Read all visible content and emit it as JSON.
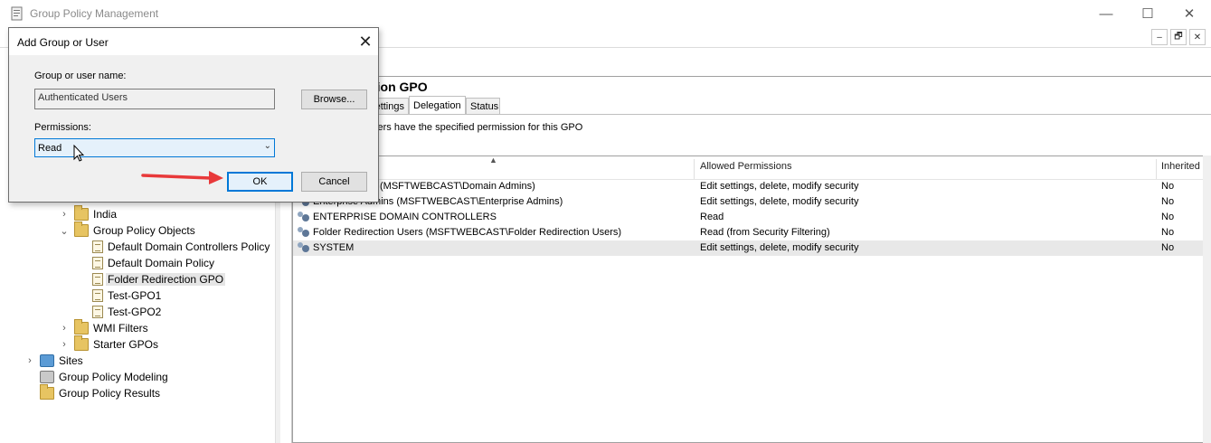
{
  "window": {
    "title": "Group Policy Management",
    "controls": [
      "—",
      "☐",
      "✕"
    ]
  },
  "mdi_controls": [
    "–",
    "🗗",
    "✕"
  ],
  "tree": {
    "nodes": [
      {
        "label": "India",
        "icon": "folder-icon",
        "expander": "›",
        "selected": false
      },
      {
        "label": "Group Policy Objects",
        "icon": "folder-icon",
        "expander": "⌄",
        "selected": false
      },
      {
        "label": "Default Domain Controllers Policy",
        "icon": "gpo-icon",
        "expander": "",
        "selected": false
      },
      {
        "label": "Default Domain Policy",
        "icon": "gpo-icon",
        "expander": "",
        "selected": false
      },
      {
        "label": "Folder Redirection GPO",
        "icon": "gpo-icon",
        "expander": "",
        "selected": true
      },
      {
        "label": "Test-GPO1",
        "icon": "gpo-icon",
        "expander": "",
        "selected": false
      },
      {
        "label": "Test-GPO2",
        "icon": "gpo-icon",
        "expander": "",
        "selected": false
      },
      {
        "label": "WMI Filters",
        "icon": "folder-icon",
        "expander": "›",
        "selected": false
      },
      {
        "label": "Starter GPOs",
        "icon": "folder-icon",
        "expander": "›",
        "selected": false
      },
      {
        "label": "Sites",
        "icon": "sites-icon",
        "expander": "›",
        "selected": false
      },
      {
        "label": "Group Policy Modeling",
        "icon": "modeling-icon",
        "expander": "",
        "selected": false
      },
      {
        "label": "Group Policy Results",
        "icon": "results-icon",
        "expander": "",
        "selected": false
      }
    ]
  },
  "right_pane": {
    "title": "tion GPO",
    "tabs": [
      {
        "label": "ettings",
        "active": false
      },
      {
        "label": "Delegation",
        "active": true
      },
      {
        "label": "Status",
        "active": false
      }
    ],
    "description": "sers have the specified permission for this GPO",
    "columns": [
      "Allowed Permissions",
      "Inherited"
    ],
    "rows": [
      {
        "name": "(MSFTWEBCAST\\Domain Admins)",
        "permissions": "Edit settings, delete, modify security",
        "inherited": "No",
        "highlighted": false
      },
      {
        "name": "Enterprise Admins (MSFTWEBCAST\\Enterprise Admins)",
        "permissions": "Edit settings, delete, modify security",
        "inherited": "No",
        "highlighted": false
      },
      {
        "name": "ENTERPRISE DOMAIN CONTROLLERS",
        "permissions": "Read",
        "inherited": "No",
        "highlighted": false
      },
      {
        "name": "Folder Redirection Users (MSFTWEBCAST\\Folder Redirection Users)",
        "permissions": "Read (from Security Filtering)",
        "inherited": "No",
        "highlighted": false
      },
      {
        "name": "SYSTEM",
        "permissions": "Edit settings, delete, modify security",
        "inherited": "No",
        "highlighted": true
      }
    ]
  },
  "dialog": {
    "title": "Add Group or User",
    "close_glyph": "✕",
    "name_label": "Group or user name:",
    "name_value": "Authenticated Users",
    "browse_label": "Browse...",
    "permissions_label": "Permissions:",
    "permissions_value": "Read",
    "ok_label": "OK",
    "cancel_label": "Cancel"
  },
  "colors": {
    "accent": "#0078d7",
    "annotation_arrow": "#e8393a"
  }
}
